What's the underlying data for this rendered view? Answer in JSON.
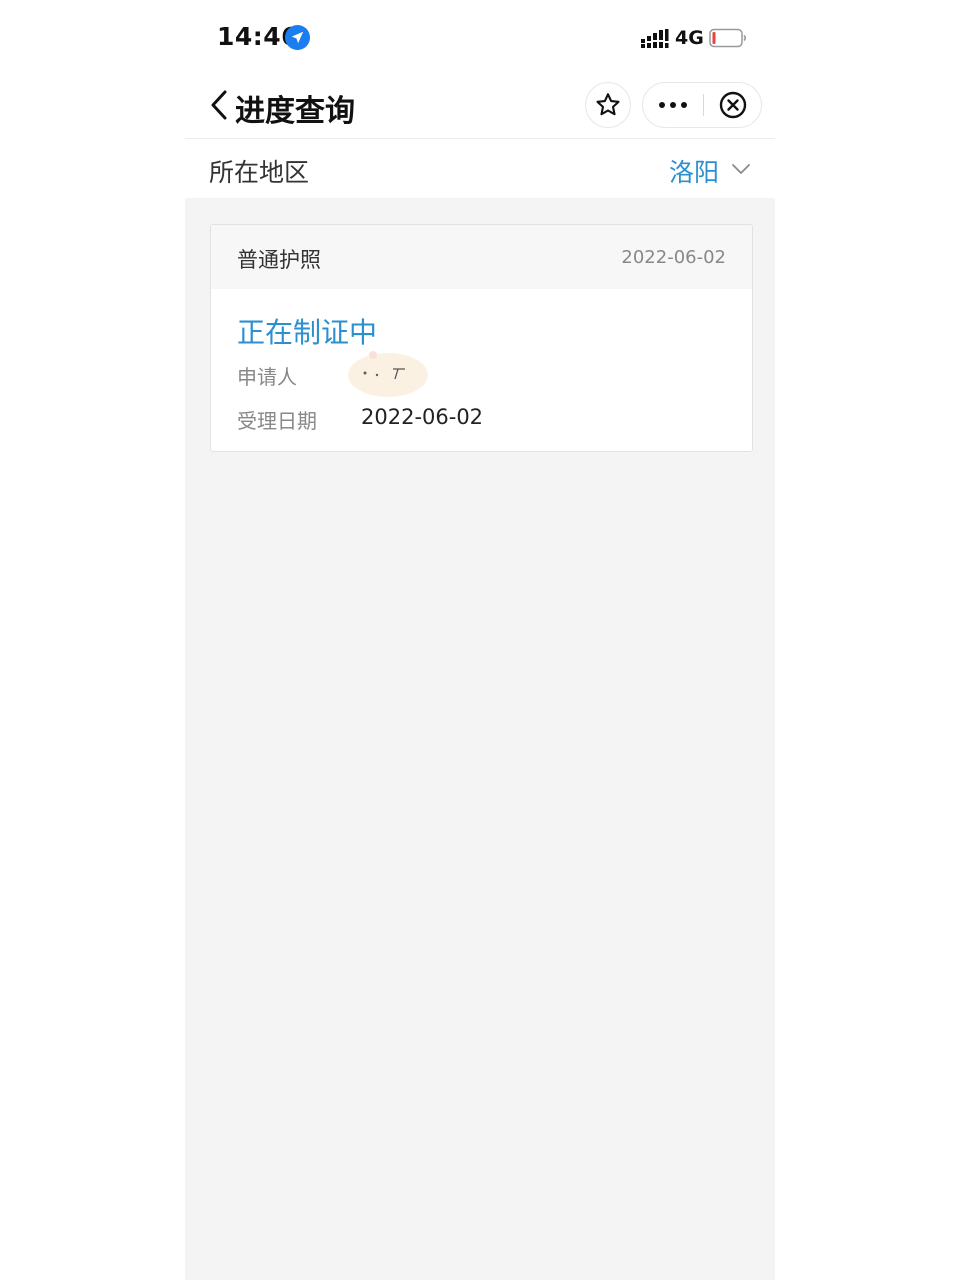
{
  "status_bar": {
    "time": "14:46",
    "network": "4G",
    "icons": [
      "location-arrow-icon",
      "signal-icon",
      "battery-icon"
    ]
  },
  "nav": {
    "title": "进度查询",
    "icons": [
      "chevron-left-icon",
      "star-icon",
      "more-icon",
      "close-circle-icon"
    ]
  },
  "region": {
    "label": "所在地区",
    "value": "洛阳",
    "icon": "chevron-down-icon"
  },
  "card": {
    "type": "普通护照",
    "date": "2022-06-02",
    "status": "正在制证中",
    "applicant_label": "申请人",
    "applicant_name": "",
    "accept_label": "受理日期",
    "accept_value": "2022-06-02"
  },
  "colors": {
    "accent": "#2b8fd0",
    "background": "#f4f4f4",
    "location_icon": "#1a7ef0"
  }
}
